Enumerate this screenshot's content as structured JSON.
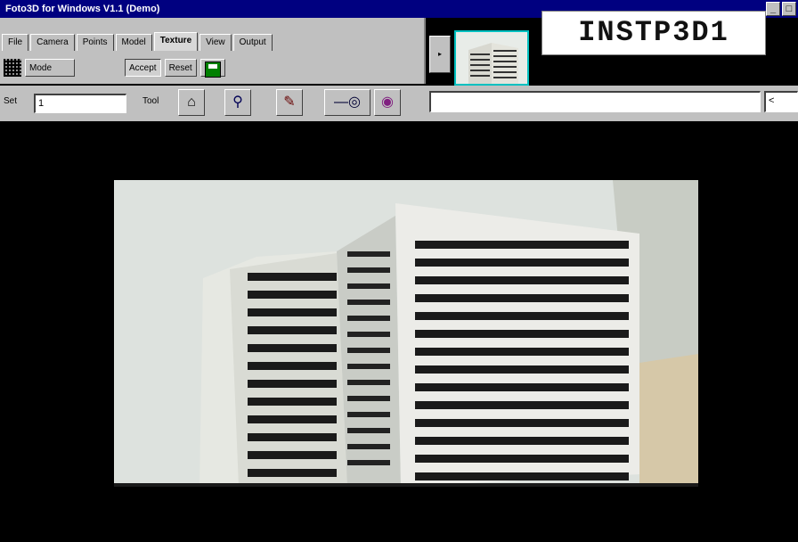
{
  "window": {
    "title": "Foto3D for Windows V1.1 (Demo)",
    "min_label": "_",
    "max_label": "□"
  },
  "image_label": "INSTP3D1",
  "tabs": [
    {
      "label": "File"
    },
    {
      "label": "Camera"
    },
    {
      "label": "Points"
    },
    {
      "label": "Model"
    },
    {
      "label": "Texture"
    },
    {
      "label": "View"
    },
    {
      "label": "Output"
    }
  ],
  "row2": {
    "mode_label": "Mode",
    "btn_a": "Accept",
    "btn_b": "Reset"
  },
  "toolbar": {
    "label_left": "Set",
    "field_left_value": "1",
    "label_tools": "Tool",
    "status_value": "",
    "right_edge": "<"
  },
  "icons": {
    "grid": "grid-icon",
    "disk": "save-icon",
    "tools": [
      "camera-icon",
      "zoom-icon",
      "point-icon",
      "line-icon",
      "eye-icon"
    ]
  },
  "colors": {
    "titlebar": "#000080",
    "chrome": "#c0c0c0",
    "thumb_border": "#00c0c0",
    "background": "#000000"
  }
}
